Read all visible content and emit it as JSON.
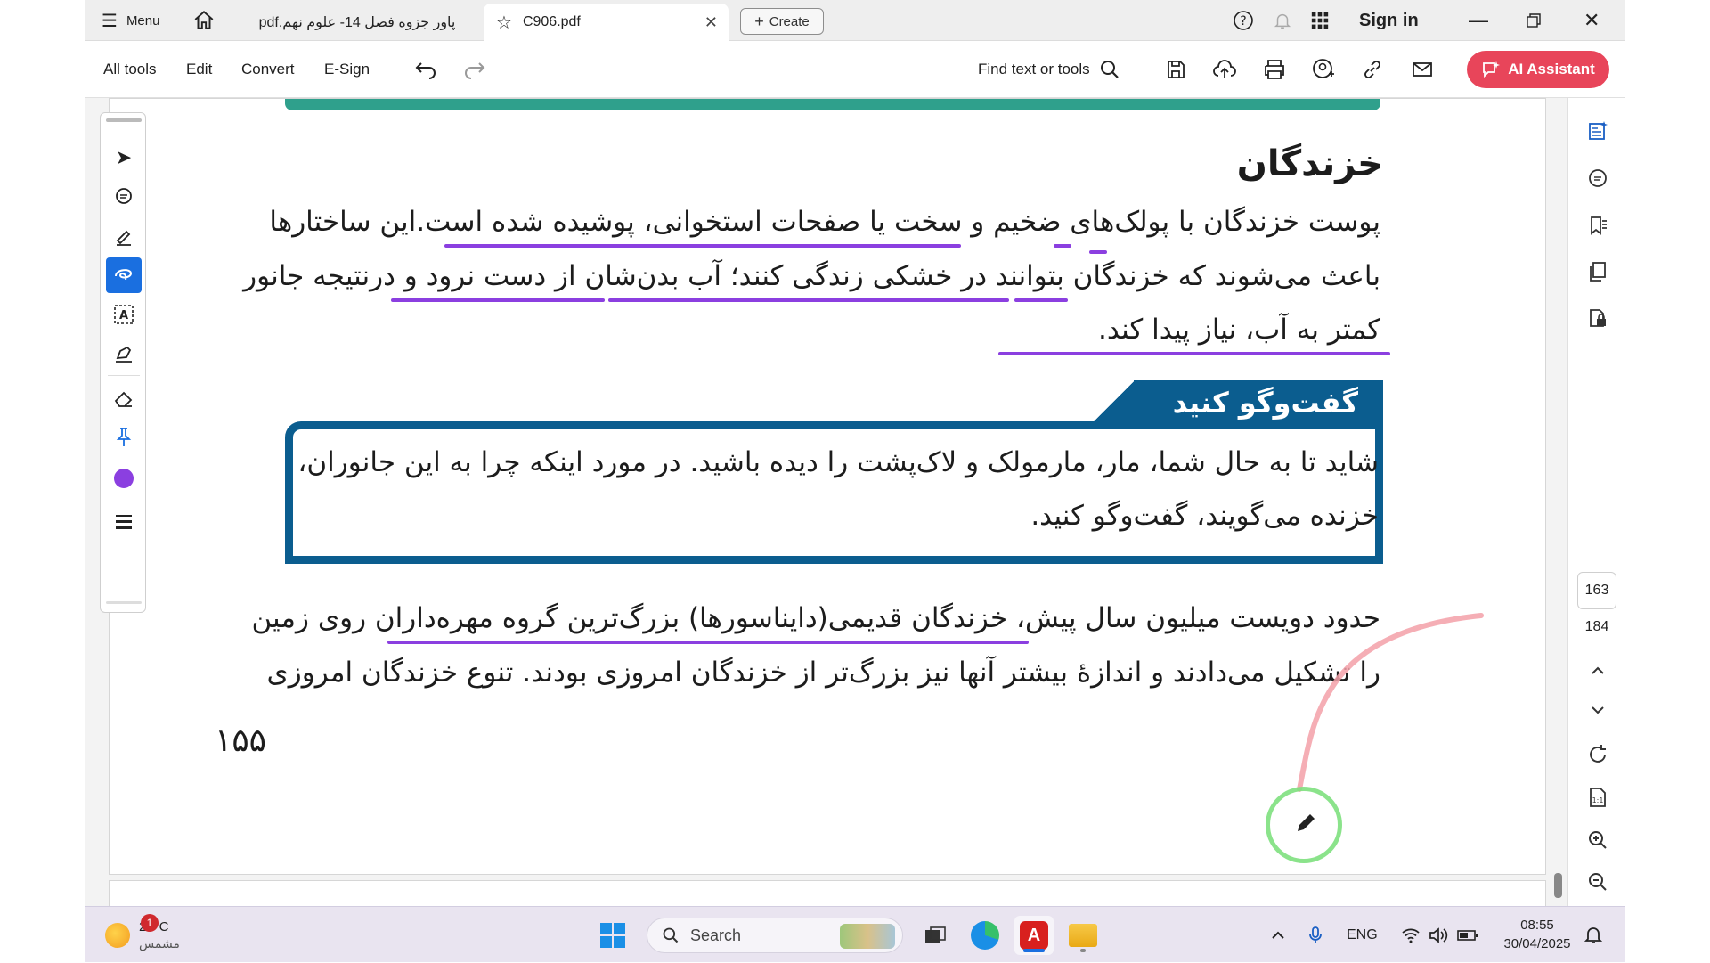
{
  "titlebar": {
    "menu_label": "Menu",
    "tabs": [
      {
        "label": "پاور جزوه فصل 14- علوم نهم.pdf"
      },
      {
        "label": "C906.pdf"
      }
    ],
    "create_label": "Create",
    "sign_in_label": "Sign in"
  },
  "toolbar": {
    "all_tools": "All tools",
    "edit": "Edit",
    "convert": "Convert",
    "esign": "E-Sign",
    "find_label": "Find text or tools",
    "ai_assistant": "AI Assistant"
  },
  "document": {
    "heading": "خزندگان",
    "para1": [
      "پوست خزندگان با پولک‌های ضخیم و سخت یا صفحات استخوانی، پوشیده شده است.این ساختارها",
      "باعث می‌شوند که خزندگان بتوانند در خشکی زندگی کنند؛ آب بدن‌شان از دست نرود و درنتیجه جانور",
      "کمتر به آب، نیاز پیدا کند."
    ],
    "box_title": "گفت‌وگو کنید",
    "box_text": [
      "شاید تا به حال شما، مار، مارمولک و لاک‌پشت را دیده باشید. در مورد اینکه چرا به این جانوران،",
      "خزنده می‌گویند، گفت‌وگو کنید."
    ],
    "para2": [
      "حدود دویست میلیون سال پیش، خزندگان قدیمی(دایناسورها) بزرگ‌ترین گروه مهره‌داران روی زمین",
      "را تشکیل می‌دادند و اندازهٔ بیشتر آنها نیز بزرگ‌تر از خزندگان امروزی بودند. تنوع خزندگان امروزی"
    ],
    "page_number": "۱۵۵",
    "underline_color": "#8b3fe0"
  },
  "navigation": {
    "current_page": "163",
    "total_pages": "184"
  },
  "taskbar": {
    "weather_temp": "26°C",
    "weather_desc": "مشمس",
    "notification_count": "1",
    "search_label": "Search",
    "language": "ENG",
    "time": "08:55",
    "date": "30/04/2025"
  },
  "colors": {
    "accent_blue": "#1a6fe0",
    "box_blue": "#0b5d8f",
    "ai_red": "#e8455a",
    "header_green": "#2fa08c"
  }
}
